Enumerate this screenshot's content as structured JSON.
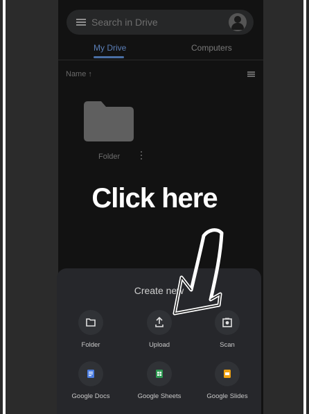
{
  "search": {
    "placeholder": "Search in Drive"
  },
  "tabs": [
    {
      "label": "My Drive"
    },
    {
      "label": "Computers"
    }
  ],
  "sort": {
    "label": "Name ↑"
  },
  "folder": {
    "label": "Folder"
  },
  "overlay": {
    "text": "Click here"
  },
  "sheet": {
    "title": "Create new",
    "options": [
      {
        "label": "Folder"
      },
      {
        "label": "Upload"
      },
      {
        "label": "Scan"
      },
      {
        "label": "Google Docs"
      },
      {
        "label": "Google Sheets"
      },
      {
        "label": "Google Slides"
      }
    ]
  },
  "colors": {
    "docs": "#4a7ce0",
    "sheets": "#2e9a52",
    "slides": "#f0a313",
    "accent": "#5b7fb8"
  }
}
